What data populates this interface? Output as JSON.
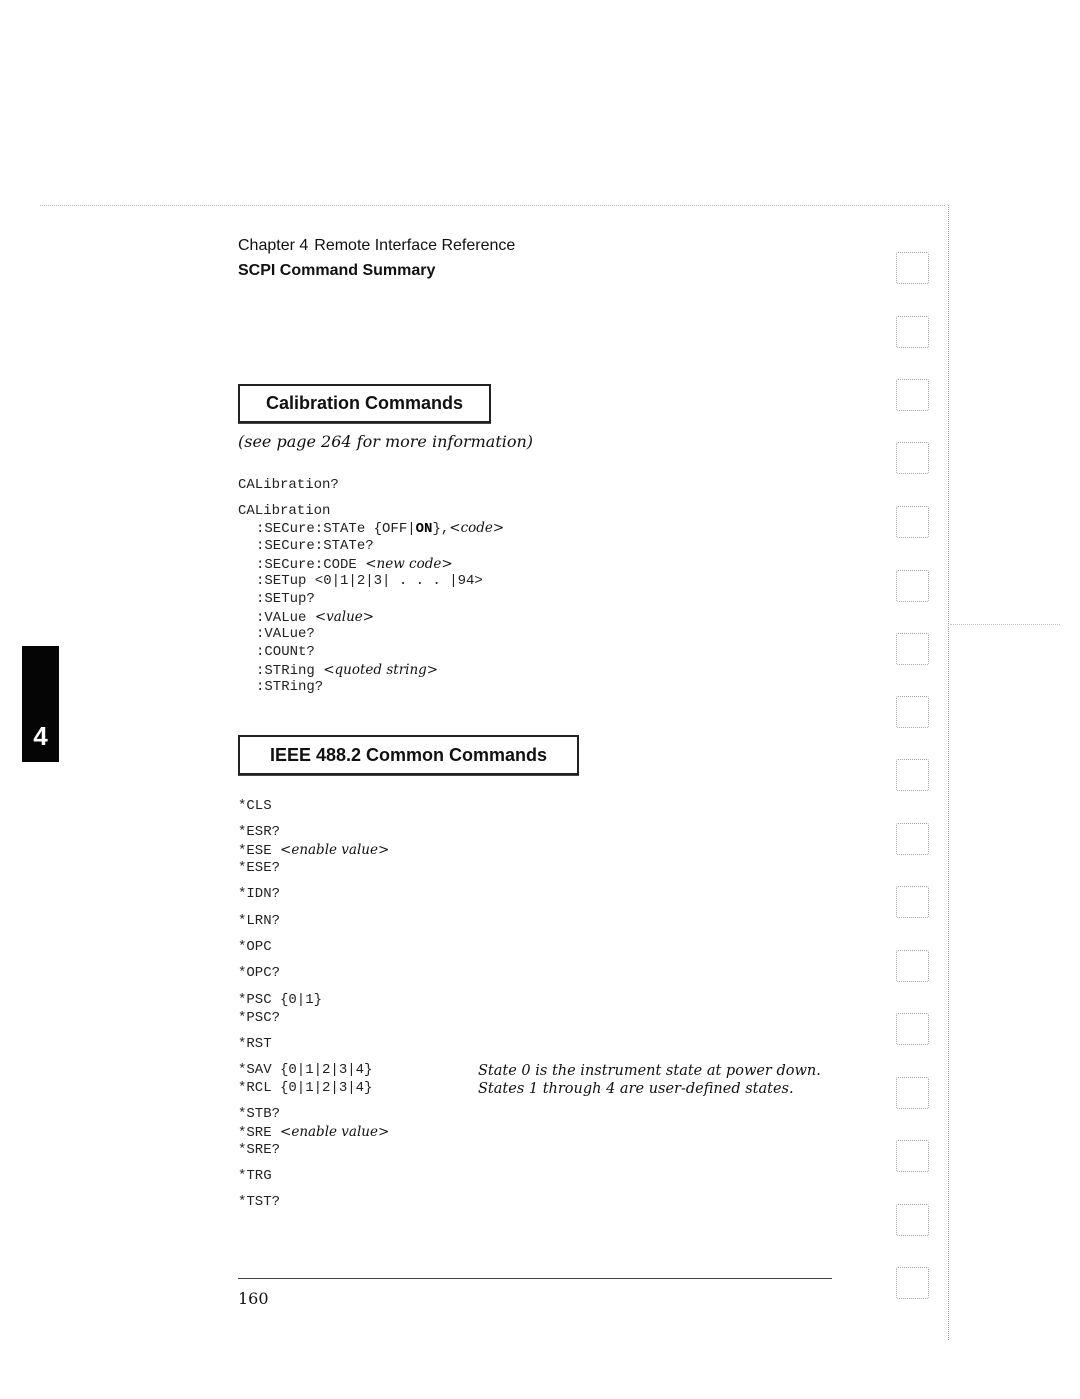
{
  "header": {
    "chapter_label": "Chapter 4",
    "chapter_title": "Remote Interface Reference",
    "section_title": "SCPI Command Summary"
  },
  "chapter_tab": {
    "number": "4"
  },
  "calibration": {
    "heading": "Calibration Commands",
    "note": "(see page 264 for more information)",
    "query": "CALibration?",
    "root": "CALibration",
    "subcommands": [
      {
        "cmd": ":SECure:STATe ",
        "pre": "{OFF|",
        "bold": "ON",
        "post": "},",
        "param": "<code>"
      },
      {
        "cmd": ":SECure:STATe?"
      },
      {
        "cmd": ":SECure:CODE ",
        "param": "<new code>"
      },
      {
        "cmd": ":SETup <0|1|2|3| . . . |94>"
      },
      {
        "cmd": ":SETup?"
      },
      {
        "cmd": ":VALue ",
        "param": "<value>"
      },
      {
        "cmd": ":VALue?"
      },
      {
        "cmd": ":COUNt?"
      },
      {
        "cmd": ":STRing ",
        "param": "<quoted string>"
      },
      {
        "cmd": ":STRing?"
      }
    ]
  },
  "ieee": {
    "heading": "IEEE 488.2 Common Commands",
    "commands": [
      {
        "cmd": "*CLS"
      },
      {
        "cmd": "*ESR?"
      },
      {
        "cmd": "*ESE ",
        "param": "<enable value>"
      },
      {
        "cmd": "*ESE?"
      },
      {
        "cmd": "*IDN?"
      },
      {
        "cmd": "*LRN?"
      },
      {
        "cmd": "*OPC"
      },
      {
        "cmd": "*OPC?"
      },
      {
        "cmd": "*PSC {0|1}"
      },
      {
        "cmd": "*PSC?"
      },
      {
        "cmd": "*RST"
      },
      {
        "cmd": "*SAV {0|1|2|3|4}"
      },
      {
        "cmd": "*RCL {0|1|2|3|4}"
      },
      {
        "cmd": "*STB?"
      },
      {
        "cmd": "*SRE ",
        "param": "<enable value>"
      },
      {
        "cmd": "*SRE?"
      },
      {
        "cmd": "*TRG"
      },
      {
        "cmd": "*TST?"
      }
    ],
    "state_notes": [
      "State 0 is the instrument state at power down.",
      "States 1 through 4 are user-defined states."
    ]
  },
  "footer": {
    "page_number": "160"
  }
}
